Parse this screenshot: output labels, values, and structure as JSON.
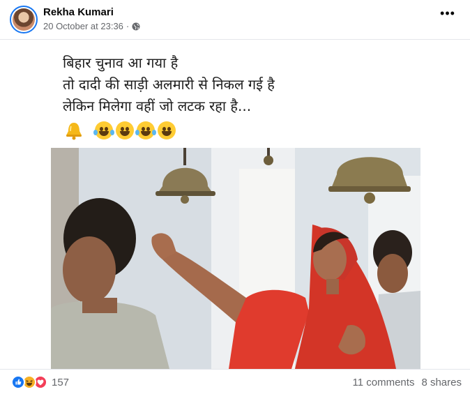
{
  "post": {
    "author": "Rekha Kumari",
    "timestamp": "20 October at 23:36",
    "separator": "·",
    "privacy_icon": "globe-icon",
    "more_label": "•••"
  },
  "meme": {
    "caption_lines": [
      "बिहार चुनाव आ गया है",
      "तो दादी की साड़ी अलमारी से निकल गई है",
      "लेकिन मिलेगा वहीं जो लटक रहा है..."
    ],
    "emojis": [
      "bell-emoji",
      "tears-of-joy-emoji",
      "grinning-emoji",
      "tears-of-joy-emoji",
      "grinning-emoji"
    ]
  },
  "footer": {
    "reaction_icons": [
      "like-icon",
      "haha-icon",
      "love-icon"
    ],
    "reaction_count": "157",
    "comments": "11 comments",
    "shares": "8 shares"
  },
  "colors": {
    "accent": "#1877f2",
    "secondary_text": "#65676b",
    "divider": "#e4e6eb",
    "saree": "#d9352a"
  }
}
